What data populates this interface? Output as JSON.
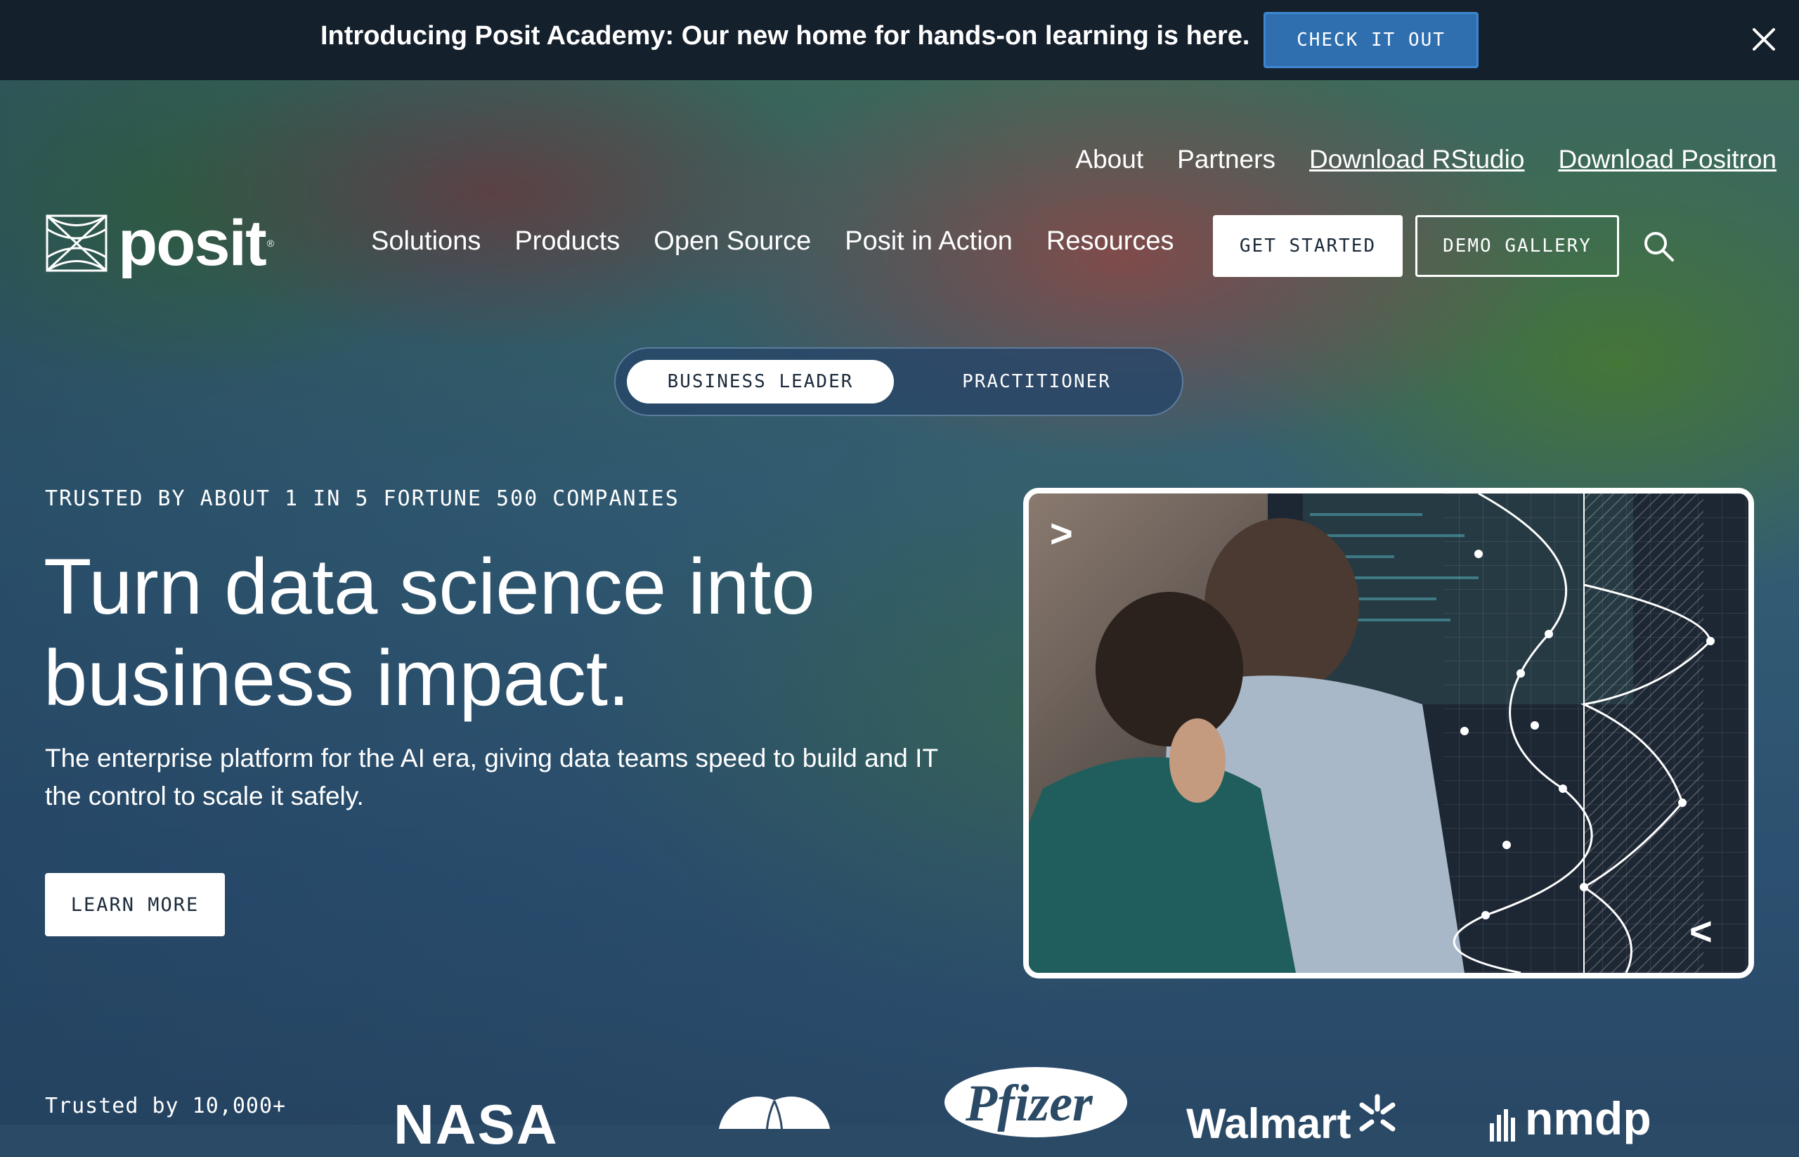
{
  "announcement": {
    "text": "Introducing Posit Academy: Our new home for hands-on learning is here.",
    "button_label": "CHECK IT OUT"
  },
  "utility_nav": [
    {
      "label": "About"
    },
    {
      "label": "Partners"
    },
    {
      "label": "Download RStudio"
    },
    {
      "label": "Download Positron"
    }
  ],
  "brand": {
    "name": "posit",
    "mark": "®"
  },
  "main_nav": [
    {
      "label": "Solutions"
    },
    {
      "label": "Products"
    },
    {
      "label": "Open Source"
    },
    {
      "label": "Posit in Action"
    },
    {
      "label": "Resources"
    }
  ],
  "header_buttons": {
    "get_started": "GET STARTED",
    "demo_gallery": "DEMO GALLERY"
  },
  "audience_toggle": {
    "active": "BUSINESS LEADER",
    "inactive": "PRACTITIONER"
  },
  "hero": {
    "eyebrow": "TRUSTED BY ABOUT 1 IN 5 FORTUNE 500 COMPANIES",
    "headline": "Turn data science into business impact.",
    "subtitle": "The enterprise platform for the AI era, giving data teams speed to build and IT the control to scale it safely.",
    "cta": "LEARN MORE"
  },
  "hero_image": {
    "prev_glyph": ">",
    "next_glyph": "<"
  },
  "trusted_row": {
    "label": "Trusted by 10,000+",
    "logos": [
      "NASA",
      "Pfizer",
      "Walmart",
      "nmdp"
    ]
  },
  "colors": {
    "announcement_bg": "#15202d",
    "announcement_button": "#2f6fb0",
    "hero_overlay": "#2b4a66",
    "white": "#ffffff"
  }
}
